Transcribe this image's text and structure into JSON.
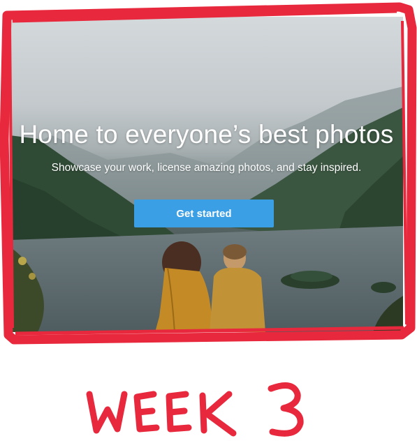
{
  "hero": {
    "title": "Home to everyone’s best photos",
    "subtitle": "Showcase your work, license amazing photos, and stay inspired.",
    "cta_label": "Get started"
  },
  "caption": {
    "text": "WEEK 3"
  },
  "colors": {
    "frame_red": "#e8283c",
    "button_blue": "#3b9fe6",
    "caption_red": "#e8283c"
  }
}
